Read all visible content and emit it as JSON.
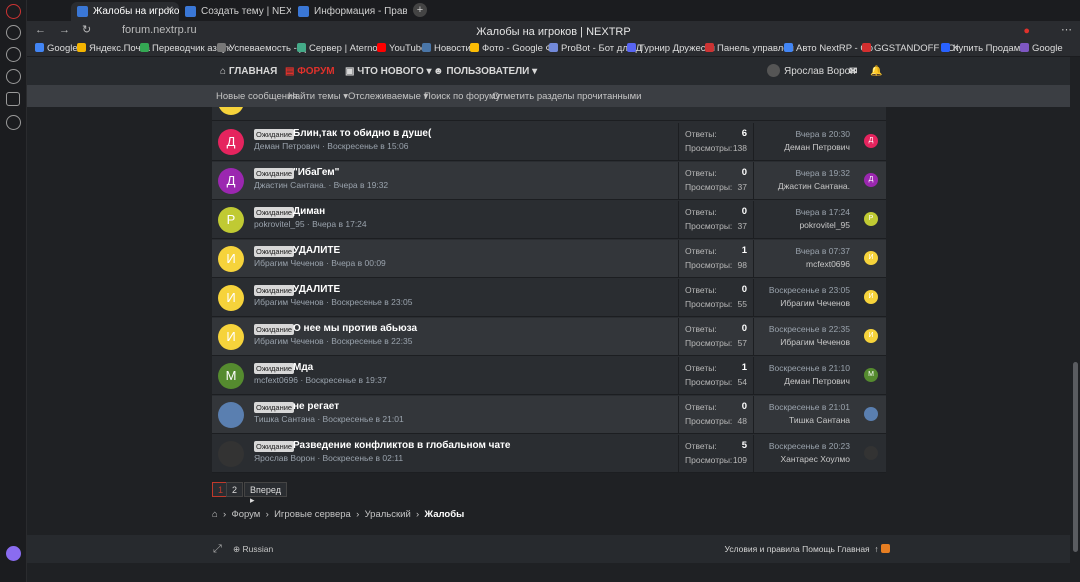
{
  "browser": {
    "tabs": [
      {
        "label": "Жалобы на игроков | NE",
        "active": true
      },
      {
        "label": "Создать тему | NEXTRP",
        "active": false
      },
      {
        "label": "Информация - Правила п",
        "active": false
      }
    ],
    "url": "forum.nextrp.ru",
    "page_title": "Жалобы на игроков | NEXTRP",
    "bookmarks": [
      "Google",
      "Яндекс.Почта",
      "Переводчик азбук",
      "Успеваемость - Д",
      "Сервер | Aternos",
      "YouTube",
      "Новости",
      "Фото - Google Фо",
      "ProBot - Бот для Д",
      "Турнир Дружески",
      "Панель управлен",
      "Авто NextRP - Go",
      "GGSTANDOFF - От",
      "Купить Продам с",
      "Google"
    ]
  },
  "nav": {
    "home": "ГЛАВНАЯ",
    "forum": "ФОРУМ",
    "whats_new": "ЧТО НОВОГО",
    "users": "ПОЛЬЗОВАТЕЛИ",
    "user_name": "Ярослав Ворон"
  },
  "subnav": [
    "Новые сообщения",
    "Найти темы",
    "Отслеживаемые",
    "Поиск по форуму",
    "Отметить разделы прочитанными"
  ],
  "threads": [
    {
      "title": "Блин,так то обидно в душе(",
      "author": "Деман Петрович",
      "date": "Воскресенье в 15:06",
      "replies": "6",
      "views": "138",
      "last_date": "Вчера в 20:30",
      "last_user": "Деман Петрович",
      "initial": "Д",
      "color": "#e5245e"
    },
    {
      "title": "\"ИбаГем\"",
      "author": "Джастин Сантана.",
      "date": "Вчера в 19:32",
      "replies": "0",
      "views": "37",
      "last_date": "Вчера в 19:32",
      "last_user": "Джастин Сантана.",
      "initial": "Д",
      "color": "#9b27b0"
    },
    {
      "title": "Диман",
      "author": "pokrovitel_95",
      "date": "Вчера в 17:24",
      "replies": "0",
      "views": "37",
      "last_date": "Вчера в 17:24",
      "last_user": "pokrovitel_95",
      "initial": "P",
      "color": "#c0ca33"
    },
    {
      "title": "УДАЛИТЕ",
      "author": "Ибрагим Чеченов",
      "date": "Вчера в 00:09",
      "replies": "1",
      "views": "98",
      "last_date": "Вчера в 07:37",
      "last_user": "mcfext0696",
      "initial": "И",
      "color": "#f6d33b"
    },
    {
      "title": "УДАЛИТЕ",
      "author": "Ибрагим Чеченов",
      "date": "Воскресенье в 23:05",
      "replies": "0",
      "views": "55",
      "last_date": "Воскресенье в 23:05",
      "last_user": "Ибрагим Чеченов",
      "initial": "И",
      "color": "#f6d33b"
    },
    {
      "title": "О нее мы против абьюза",
      "author": "Ибрагим Чеченов",
      "date": "Воскресенье в 22:35",
      "replies": "0",
      "views": "57",
      "last_date": "Воскресенье в 22:35",
      "last_user": "Ибрагим Чеченов",
      "initial": "И",
      "color": "#f6d33b"
    },
    {
      "title": "Мда",
      "author": "mcfext0696",
      "date": "Воскресенье в 19:37",
      "replies": "1",
      "views": "54",
      "last_date": "Воскресенье в 21:10",
      "last_user": "Деман Петрович",
      "initial": "M",
      "color": "#558b2f"
    },
    {
      "title": "не регает",
      "author": "Тишка Сантана",
      "date": "Воскресенье в 21:01",
      "replies": "0",
      "views": "48",
      "last_date": "Воскресенье в 21:01",
      "last_user": "Тишка Сантана",
      "initial": "",
      "color": "#5a7fb0"
    },
    {
      "title": "Разведение конфликтов в глобальном чате",
      "author": "Ярослав Ворон",
      "date": "Воскресенье в 02:11",
      "replies": "5",
      "views": "109",
      "last_date": "Воскресенье в 20:23",
      "last_user": "Хантарес Хоулмо",
      "initial": "",
      "color": "#333"
    }
  ],
  "labels": {
    "badge": "Ожидание",
    "replies": "Ответы:",
    "views": "Просмотры:"
  },
  "pagination": {
    "pages": [
      "1",
      "2"
    ],
    "next": "Вперед"
  },
  "breadcrumbs": [
    "Форум",
    "Игровые сервера",
    "Уральский",
    "Жалобы"
  ],
  "footer": {
    "language": "Russian",
    "links": "Условия и правила   Помощь   Главная"
  }
}
